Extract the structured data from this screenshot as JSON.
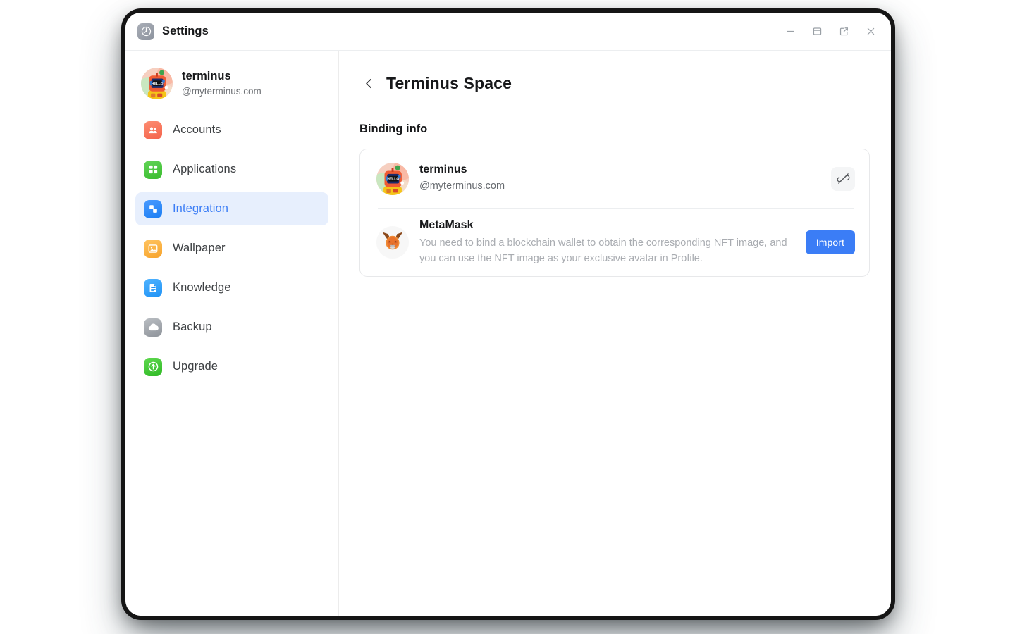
{
  "window": {
    "app_icon": "settings-gear-icon",
    "title": "Settings",
    "controls": [
      {
        "name": "minimize-button",
        "icon": "minimize-icon"
      },
      {
        "name": "restore-button",
        "icon": "window-restore-icon"
      },
      {
        "name": "popout-button",
        "icon": "external-link-icon"
      },
      {
        "name": "close-button",
        "icon": "close-icon"
      }
    ]
  },
  "sidebar": {
    "profile": {
      "avatar": "terminus-avatar",
      "name": "terminus",
      "handle": "@myterminus.com"
    },
    "items": [
      {
        "label": "Accounts",
        "icon": "accounts-icon",
        "active": false
      },
      {
        "label": "Applications",
        "icon": "applications-icon",
        "active": false
      },
      {
        "label": "Integration",
        "icon": "integration-icon",
        "active": true
      },
      {
        "label": "Wallpaper",
        "icon": "wallpaper-icon",
        "active": false
      },
      {
        "label": "Knowledge",
        "icon": "knowledge-icon",
        "active": false
      },
      {
        "label": "Backup",
        "icon": "backup-icon",
        "active": false
      },
      {
        "label": "Upgrade",
        "icon": "upgrade-icon",
        "active": false
      }
    ]
  },
  "main": {
    "back_icon": "chevron-left-icon",
    "page_title": "Terminus Space",
    "section_title": "Binding info",
    "rows": {
      "terminus": {
        "avatar": "terminus-avatar",
        "title": "terminus",
        "subtitle": "@myterminus.com",
        "action_icon": "unlink-icon"
      },
      "metamask": {
        "avatar": "metamask-fox-icon",
        "title": "MetaMask",
        "description": "You need to bind a blockchain wallet to obtain the corresponding NFT image, and you can use the NFT image as your exclusive avatar in Profile.",
        "action_label": "Import"
      }
    }
  },
  "colors": {
    "accent_blue": "#3b7df6",
    "active_nav_bg": "#e7effd",
    "muted_text": "#a9acb1",
    "sub_text": "#666a6f",
    "card_border": "#e7e8ea"
  }
}
